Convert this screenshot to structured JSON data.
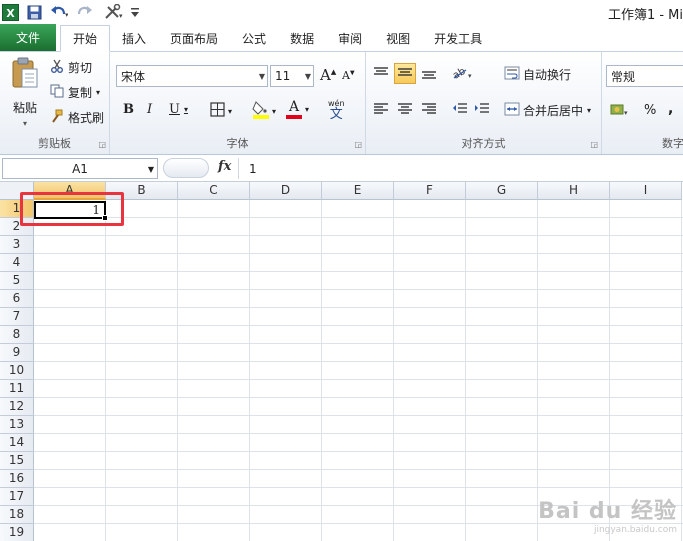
{
  "window": {
    "title": "工作簿1 - Mi"
  },
  "quick_access": {
    "icons": [
      "excel-logo-icon",
      "save-icon",
      "undo-icon",
      "redo-icon",
      "tools-icon",
      "customize-icon"
    ]
  },
  "tabs": [
    {
      "label": "文件"
    },
    {
      "label": "开始"
    },
    {
      "label": "插入"
    },
    {
      "label": "页面布局"
    },
    {
      "label": "公式"
    },
    {
      "label": "数据"
    },
    {
      "label": "审阅"
    },
    {
      "label": "视图"
    },
    {
      "label": "开发工具"
    }
  ],
  "ribbon": {
    "clipboard": {
      "paste": "粘贴",
      "cut": "剪切",
      "copy": "复制",
      "format_painter": "格式刷",
      "label": "剪贴板"
    },
    "font": {
      "name": "宋体",
      "size": "11",
      "bold": "B",
      "italic": "I",
      "underline": "U",
      "font_color_letter": "A",
      "label": "字体",
      "wen": "wén",
      "wen_char": "文"
    },
    "alignment": {
      "wrap": "自动换行",
      "merge": "合并后居中",
      "label": "对齐方式"
    },
    "number": {
      "format": "常规",
      "percent": "%",
      "comma": ",",
      "label": "数字"
    }
  },
  "formula_bar": {
    "name_box": "A1",
    "fx": "fx",
    "content": "1"
  },
  "grid": {
    "columns": [
      "A",
      "B",
      "C",
      "D",
      "E",
      "F",
      "G",
      "H",
      "I"
    ],
    "rows": [
      "1",
      "2",
      "3",
      "4",
      "5",
      "6",
      "7",
      "8",
      "9",
      "10",
      "11",
      "12",
      "13",
      "14",
      "15",
      "16",
      "17",
      "18",
      "19"
    ],
    "active_cell": {
      "ref": "A1",
      "value": "1"
    }
  },
  "watermark": {
    "main": "Bai du 经验",
    "sub": "jingyan.baidu.com"
  },
  "colors": {
    "file_tab": "#1f7a35",
    "highlight": "#e8343f",
    "active_header": "#f2c46a"
  }
}
